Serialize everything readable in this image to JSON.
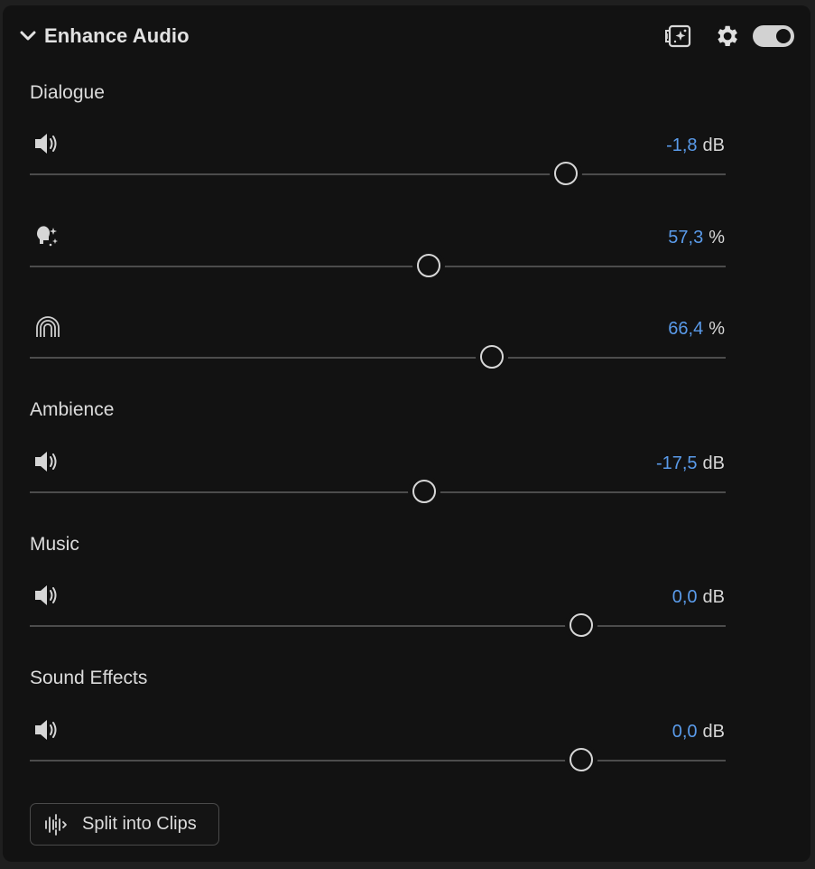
{
  "header": {
    "title": "Enhance Audio",
    "collapse_icon": "chevron-down-icon",
    "icons": [
      "compare-icon",
      "gear-icon"
    ],
    "enabled": true
  },
  "sections": [
    {
      "label": "Dialogue",
      "controls": [
        {
          "icon": "speaker-icon",
          "value": "-1,8",
          "unit": "dB",
          "position": 0.77
        },
        {
          "icon": "speech-enhance-icon",
          "value": "57,3",
          "unit": "%",
          "position": 0.573
        },
        {
          "icon": "reverb-icon",
          "value": "66,4",
          "unit": "%",
          "position": 0.664
        }
      ]
    },
    {
      "label": "Ambience",
      "controls": [
        {
          "icon": "speaker-icon",
          "value": "-17,5",
          "unit": "dB",
          "position": 0.567
        }
      ]
    },
    {
      "label": "Music",
      "controls": [
        {
          "icon": "speaker-icon",
          "value": "0,0",
          "unit": "dB",
          "position": 0.793
        }
      ]
    },
    {
      "label": "Sound Effects",
      "controls": [
        {
          "icon": "speaker-icon",
          "value": "0,0",
          "unit": "dB",
          "position": 0.793
        }
      ]
    }
  ],
  "footer": {
    "split_label": "Split into Clips",
    "split_icon": "split-waveform-icon"
  },
  "colors": {
    "panel_background": "#121212",
    "value_accent": "#5a9bea",
    "track": "#4c4c4c",
    "thumb_border": "#d7d7d7"
  }
}
